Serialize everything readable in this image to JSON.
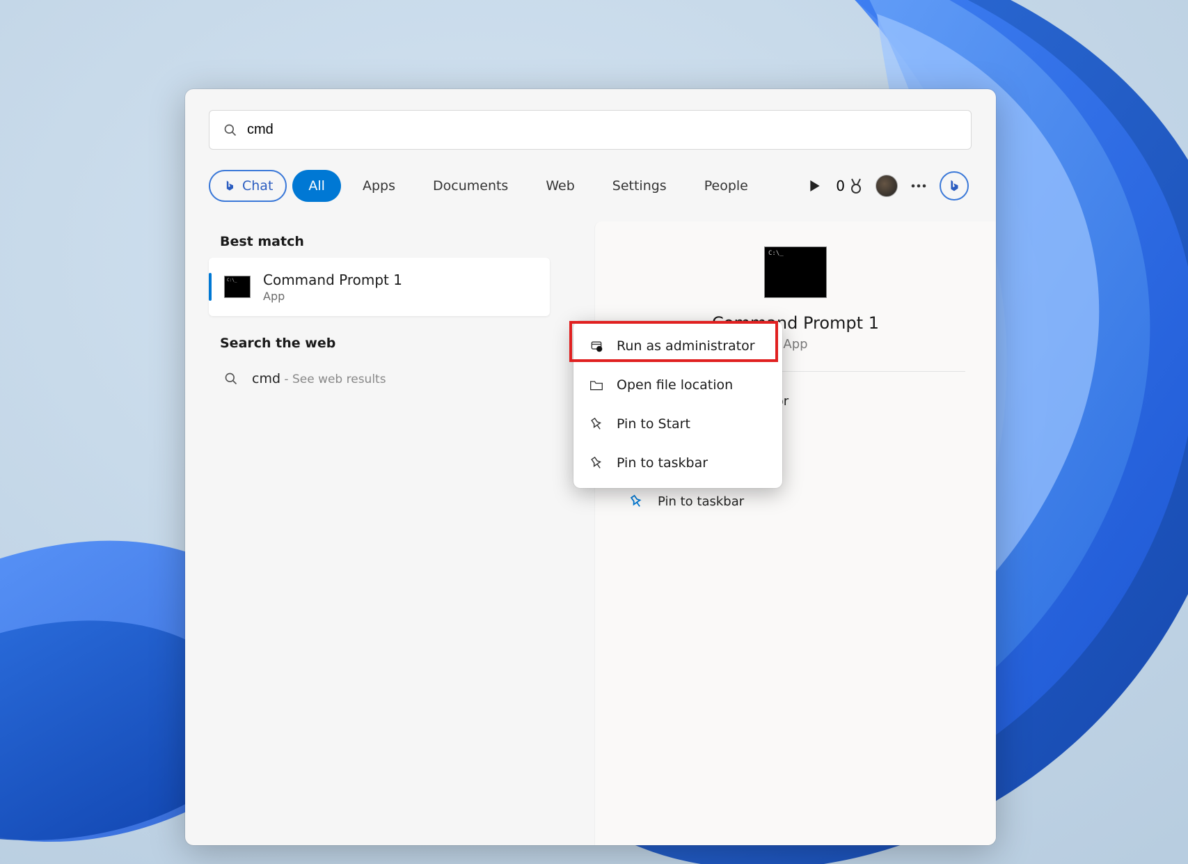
{
  "search": {
    "value": "cmd"
  },
  "filters": {
    "chat": "Chat",
    "all": "All",
    "apps": "Apps",
    "documents": "Documents",
    "web": "Web",
    "settings": "Settings",
    "people": "People"
  },
  "rewards": {
    "count": "0"
  },
  "sections": {
    "best_match": "Best match",
    "search_web": "Search the web"
  },
  "best_match": {
    "name": "Command Prompt 1",
    "kind": "App"
  },
  "web_result": {
    "term": "cmd",
    "suffix": " - See web results"
  },
  "preview": {
    "name": "Command Prompt 1",
    "kind": "App",
    "actions": {
      "run_admin": "Run as administrator",
      "open_loc": "Open file location",
      "pin_start": "Pin to Start",
      "pin_taskbar": "Pin to taskbar"
    }
  },
  "context_menu": {
    "run_admin": "Run as administrator",
    "open_loc": "Open file location",
    "pin_start": "Pin to Start",
    "pin_taskbar": "Pin to taskbar"
  }
}
